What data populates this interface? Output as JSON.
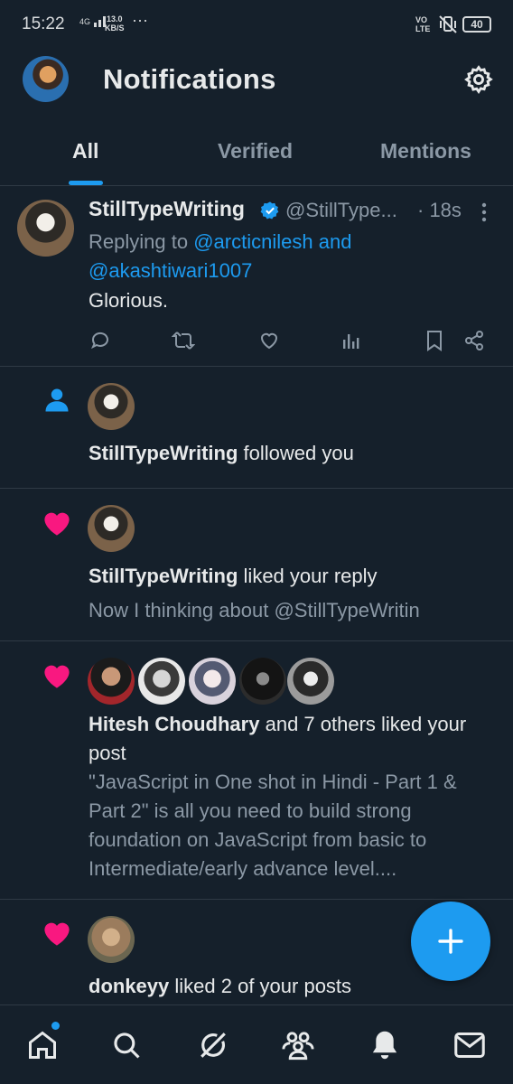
{
  "status_bar": {
    "time": "15:22",
    "network_label": "4G",
    "speed_value": "13.0",
    "speed_unit": "KB/S",
    "more": "···",
    "volte_top": "VO",
    "volte_bottom": "LTE",
    "battery": "40"
  },
  "header": {
    "title": "Notifications",
    "settings_icon": "gear-icon"
  },
  "tabs": [
    {
      "label": "All",
      "active": true
    },
    {
      "label": "Verified",
      "active": false
    },
    {
      "label": "Mentions",
      "active": false
    }
  ],
  "tweet": {
    "name": "StillTypeWriting",
    "handle": "@StillType...",
    "time": "· 18s",
    "replying_prefix": "Replying to",
    "reply_to_1": "@arcticnilesh",
    "reply_and": "and",
    "reply_to_2": "@akashtiwari1007",
    "text": "Glorious."
  },
  "notifications": [
    {
      "type": "follow",
      "icon": "person-icon",
      "name": "StillTypeWriting",
      "action": "followed you"
    },
    {
      "type": "like",
      "icon": "heart-icon",
      "name": "StillTypeWriting",
      "action": "liked your reply",
      "preview": "Now I thinking about @StillTypeWritin"
    },
    {
      "type": "like",
      "icon": "heart-icon",
      "name": "Hitesh Choudhary",
      "action": "and 7 others liked your post",
      "preview": "\"JavaScript in One shot in Hindi - Part 1 & Part 2\" is all you need to build strong foundation on JavaScript from basic to Intermediate/early advance level...."
    },
    {
      "type": "like",
      "icon": "heart-icon",
      "name": "donkeyy",
      "action": "liked 2 of your posts"
    }
  ],
  "fab": {
    "icon": "plus-icon"
  },
  "bottom_nav": [
    "home-icon",
    "search-icon",
    "grok-icon",
    "communities-icon",
    "notifications-bell-icon",
    "messages-icon"
  ],
  "colors": {
    "background": "#15202b",
    "accent": "#1d9bf0",
    "heart": "#f91880",
    "muted": "#8b98a5"
  }
}
